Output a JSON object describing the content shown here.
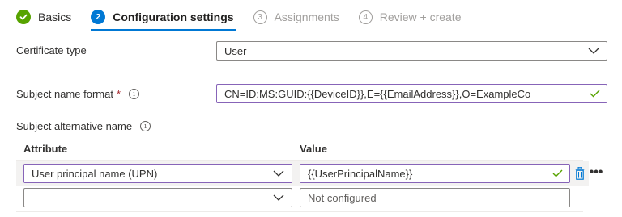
{
  "wizard": {
    "steps": [
      {
        "number": "",
        "label": "Basics",
        "state": "done"
      },
      {
        "number": "2",
        "label": "Configuration settings",
        "state": "active"
      },
      {
        "number": "3",
        "label": "Assignments",
        "state": "pending"
      },
      {
        "number": "4",
        "label": "Review + create",
        "state": "pending"
      }
    ]
  },
  "form": {
    "certificate_type": {
      "label": "Certificate type",
      "value": "User"
    },
    "subject_name_format": {
      "label": "Subject name format",
      "required_marker": "*",
      "info_glyph": "i",
      "value": "CN=ID:MS:GUID:{{DeviceID}},E={{EmailAddress}},O=ExampleCo"
    },
    "subject_alternative_name": {
      "label": "Subject alternative name",
      "info_glyph": "i"
    }
  },
  "san_table": {
    "columns": [
      "Attribute",
      "Value"
    ],
    "rows": [
      {
        "attribute": "User principal name (UPN)",
        "value": "{{UserPrincipalName}}"
      },
      {
        "attribute": "",
        "value_placeholder": "Not configured"
      }
    ],
    "more_glyph": "•••"
  },
  "colors": {
    "accent": "#0078d4",
    "success": "#57a300",
    "focus_border": "#8764b8",
    "required": "#a4262c",
    "delete_icon": "#0078d4"
  }
}
